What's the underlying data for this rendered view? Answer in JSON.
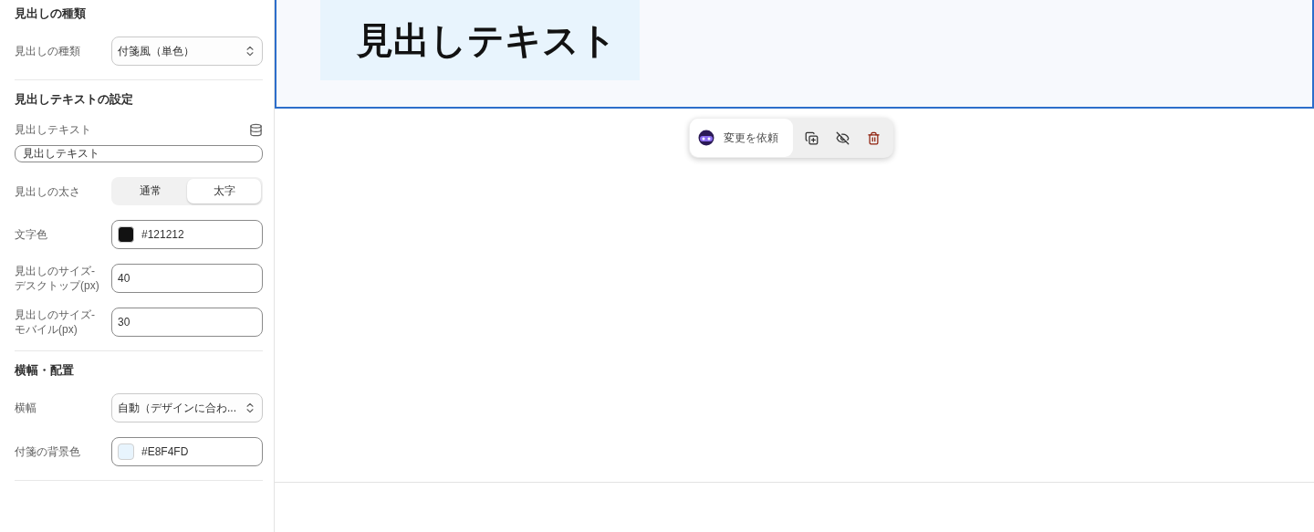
{
  "sidebar": {
    "sections": [
      {
        "title": "見出しの種類",
        "fields": [
          {
            "kind": "select",
            "label": "見出しの種類",
            "value": "付箋風（単色）"
          }
        ]
      },
      {
        "title": "見出しテキストの設定",
        "fields": [
          {
            "kind": "text",
            "label": "見出しテキスト",
            "value": "見出しテキスト"
          },
          {
            "kind": "segmented",
            "label": "見出しの太さ",
            "options": [
              {
                "label": "通常",
                "selected": false
              },
              {
                "label": "太字",
                "selected": true
              }
            ]
          },
          {
            "kind": "color",
            "label": "文字色",
            "value": "#121212"
          },
          {
            "kind": "number",
            "label": "見出しのサイズ-デスクトップ(px)",
            "value": "40"
          },
          {
            "kind": "number",
            "label": "見出しのサイズ-モバイル(px)",
            "value": "30"
          }
        ]
      },
      {
        "title": "横幅・配置",
        "fields": [
          {
            "kind": "select",
            "label": "横幅",
            "value": "自動（デザインに合わ..."
          },
          {
            "kind": "color",
            "label": "付箋の背景色",
            "value": "#E8F4FD"
          }
        ]
      }
    ]
  },
  "preview": {
    "heading": "見出しテキスト",
    "toolbar": {
      "request_label": "変更を依頼"
    }
  }
}
